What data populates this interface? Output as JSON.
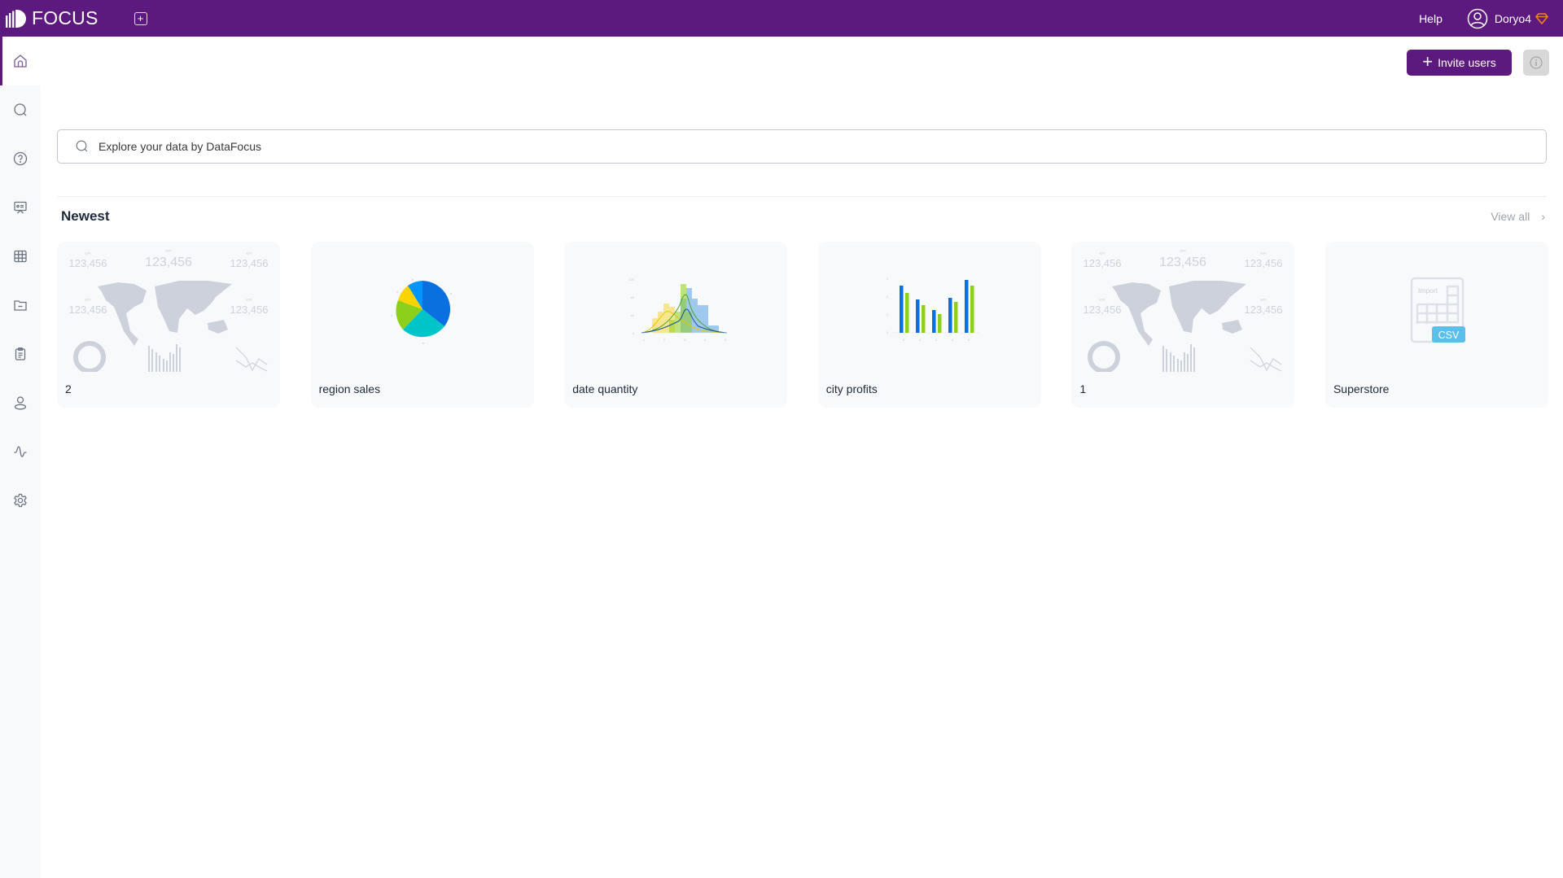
{
  "app": {
    "logo_text": "FOCUS",
    "brand_color": "#5c1a7e"
  },
  "topbar": {
    "new_tab_icon": "plus-square-icon",
    "help_label": "Help",
    "username": "Doryo4",
    "avatar_icon": "user-circle-icon",
    "badge_icon": "diamond-icon"
  },
  "sidebar": {
    "items": [
      {
        "name": "home",
        "icon": "home-icon",
        "active": true
      },
      {
        "name": "search",
        "icon": "search-icon",
        "active": false
      },
      {
        "name": "help",
        "icon": "question-circle-icon",
        "active": false
      },
      {
        "name": "presentation",
        "icon": "presentation-icon",
        "active": false
      },
      {
        "name": "tables",
        "icon": "grid-icon",
        "active": false
      },
      {
        "name": "folder",
        "icon": "folder-icon",
        "active": false
      },
      {
        "name": "clipboard",
        "icon": "clipboard-icon",
        "active": false
      },
      {
        "name": "users",
        "icon": "user-icon",
        "active": false
      },
      {
        "name": "monitor",
        "icon": "pulse-icon",
        "active": false
      },
      {
        "name": "settings",
        "icon": "gear-icon",
        "active": false
      }
    ]
  },
  "toolbar": {
    "invite_label": "Invite users",
    "info_icon": "info-icon"
  },
  "search": {
    "placeholder": "Explore your data by DataFocus",
    "value": ""
  },
  "newest": {
    "title": "Newest",
    "view_all_label": "View all",
    "cards": [
      {
        "title": "2",
        "thumbnail": "dashboard",
        "kpi_label": "KPI",
        "kpi_value": "123,456"
      },
      {
        "title": "region sales",
        "thumbnail": "pie",
        "labels": [
          "a",
          "b",
          "c",
          "d",
          "e"
        ]
      },
      {
        "title": "date quantity",
        "thumbnail": "histogram",
        "y_ticks": [
          "0",
          "40",
          "80",
          "100"
        ],
        "x_ticks": [
          "1",
          "2",
          "3",
          "4",
          "5"
        ]
      },
      {
        "title": "city profits",
        "thumbnail": "bar",
        "y_ticks": [
          "0",
          "1",
          "2",
          "3"
        ],
        "x_ticks": [
          "a",
          "b",
          "c",
          "d",
          "e"
        ]
      },
      {
        "title": "1",
        "thumbnail": "dashboard",
        "kpi_label": "KPI",
        "kpi_value": "123,456"
      },
      {
        "title": "Superstore",
        "thumbnail": "csv",
        "import_label": "Import",
        "csv_label": "CSV"
      }
    ]
  }
}
